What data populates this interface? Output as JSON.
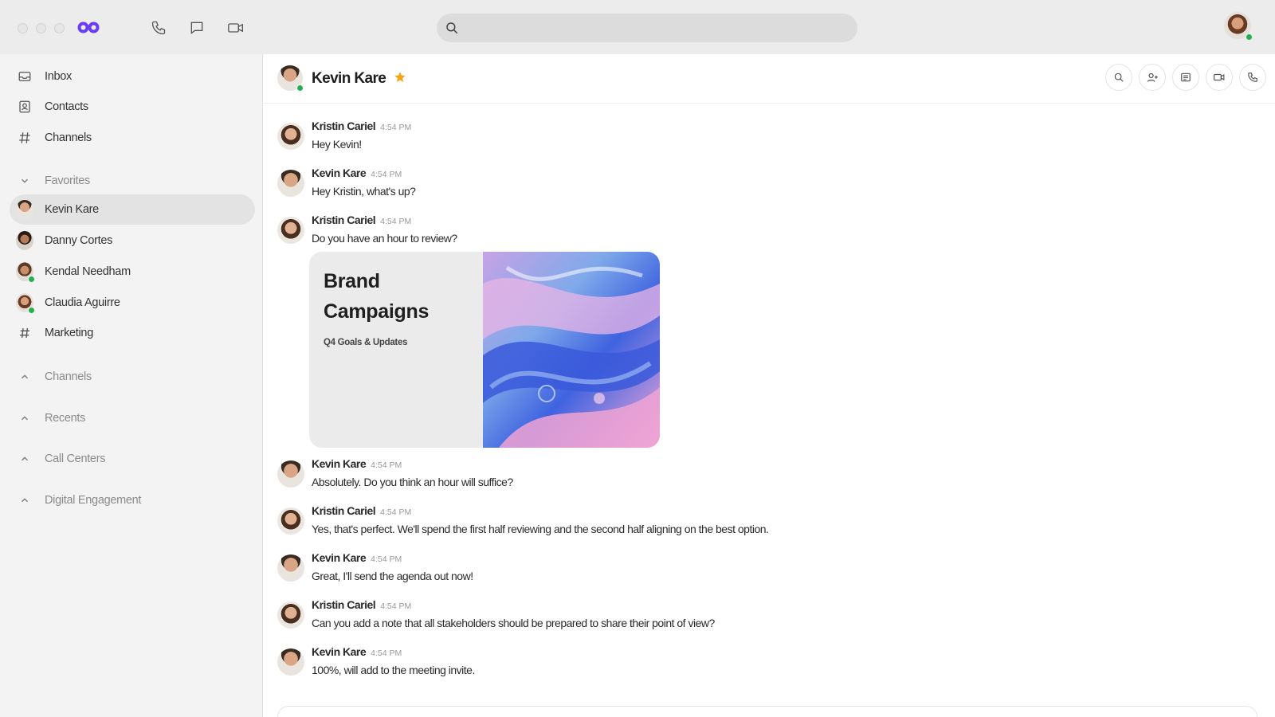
{
  "app": {
    "brand_color": "#6a3df5",
    "online_color": "#22b14c",
    "star_color": "#f2a516"
  },
  "topbar": {
    "search_placeholder": ""
  },
  "sidebar": {
    "nav": [
      {
        "label": "Inbox",
        "icon": "inbox-icon"
      },
      {
        "label": "Contacts",
        "icon": "contacts-icon"
      },
      {
        "label": "Channels",
        "icon": "channels-icon"
      }
    ],
    "favorites_label": "Favorites",
    "favorites": [
      {
        "label": "Kevin Kare",
        "online": false,
        "active": true
      },
      {
        "label": "Danny Cortes",
        "online": false
      },
      {
        "label": "Kendal Needham",
        "online": true
      },
      {
        "label": "Claudia Aguirre",
        "online": true
      },
      {
        "label": "Marketing",
        "icon": "hash-icon"
      }
    ],
    "sections": [
      "Channels",
      "Recents",
      "Call Centers",
      "Digital Engagement"
    ]
  },
  "conversation": {
    "name": "Kevin Kare",
    "starred": true,
    "messages": [
      {
        "sender": "Kristin Cariel",
        "time": "4:54 PM",
        "text": "Hey Kevin!"
      },
      {
        "sender": "Kevin Kare",
        "time": "4:54 PM",
        "text": "Hey Kristin, what's up?"
      },
      {
        "sender": "Kristin Cariel",
        "time": "4:54 PM",
        "text": "Do you have an hour to review?"
      },
      {
        "sender": "Kevin Kare",
        "time": "4:54 PM",
        "text": "Absolutely. Do you think an hour will suffice?"
      },
      {
        "sender": "Kristin Cariel",
        "time": "4:54 PM",
        "text": "Yes, that's perfect. We'll spend the first half reviewing and the second half aligning on the best option."
      },
      {
        "sender": "Kevin Kare",
        "time": "4:54 PM",
        "text": "Great, I'll send the agenda out now!"
      },
      {
        "sender": "Kristin Cariel",
        "time": "4:54 PM",
        "text": "Can you add a note that all stakeholders should be prepared to share their point of view?"
      },
      {
        "sender": "Kevin Kare",
        "time": "4:54 PM",
        "text": "100%, will add to the meeting invite."
      }
    ],
    "attachment": {
      "title": "Brand Campaigns",
      "subtitle": "Q4 Goals & Updates"
    }
  }
}
